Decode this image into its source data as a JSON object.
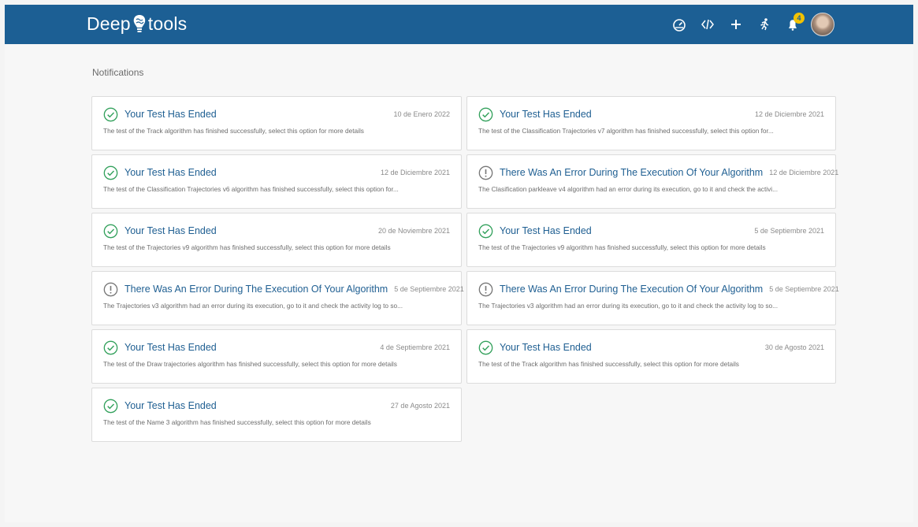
{
  "brand": {
    "name_left": "Deep",
    "name_right": "tools"
  },
  "header": {
    "icons": [
      "dashboard-icon",
      "code-icon",
      "add-icon",
      "run-icon",
      "notifications-bell-icon"
    ],
    "notification_count": "4"
  },
  "page": {
    "title": "Notifications"
  },
  "colors": {
    "header": "#1c5f94",
    "success": "#33a15c",
    "error": "#777777",
    "badge": "#f2c200"
  },
  "notifications": [
    {
      "status": "success",
      "title": "Your Test Has Ended",
      "date": "10 de Enero 2022",
      "description": "The test of the Track algorithm has finished successfully, select this option for more details"
    },
    {
      "status": "success",
      "title": "Your Test Has Ended",
      "date": "12 de Diciembre 2021",
      "description": "The test of the Classification Trajectories v7 algorithm has finished successfully, select this option for..."
    },
    {
      "status": "success",
      "title": "Your Test Has Ended",
      "date": "12 de Diciembre 2021",
      "description": "The test of the Classification Trajectories v6 algorithm has finished successfully, select this option for..."
    },
    {
      "status": "error",
      "title": "There Was An Error During The Execution Of Your Algorithm",
      "date": "12 de Diciembre 2021",
      "description": "The Clasification parkleave v4 algorithm had an error during its execution, go to it and check the activi..."
    },
    {
      "status": "success",
      "title": "Your Test Has Ended",
      "date": "20 de Noviembre 2021",
      "description": "The test of the Trajectories v9 algorithm has finished successfully, select this option for more details"
    },
    {
      "status": "success",
      "title": "Your Test Has Ended",
      "date": "5 de Septiembre 2021",
      "description": "The test of the Trajectories v9 algorithm has finished successfully, select this option for more details"
    },
    {
      "status": "error",
      "title": "There Was An Error During The Execution Of Your Algorithm",
      "date": "5 de Septiembre 2021",
      "description": "The Trajectories v3 algorithm had an error during its execution, go to it and check the activity log to so..."
    },
    {
      "status": "error",
      "title": "There Was An Error During The Execution Of Your Algorithm",
      "date": "5 de Septiembre 2021",
      "description": "The Trajectories v3 algorithm had an error during its execution, go to it and check the activity log to so..."
    },
    {
      "status": "success",
      "title": "Your Test Has Ended",
      "date": "4 de Septiembre 2021",
      "description": "The test of the Draw trajectories algorithm has finished successfully, select this option for more details"
    },
    {
      "status": "success",
      "title": "Your Test Has Ended",
      "date": "30 de Agosto 2021",
      "description": "The test of the Track algorithm has finished successfully, select this option for more details"
    },
    {
      "status": "success",
      "title": "Your Test Has Ended",
      "date": "27 de Agosto 2021",
      "description": "The test of the Name 3 algorithm has finished successfully, select this option for more details"
    }
  ]
}
